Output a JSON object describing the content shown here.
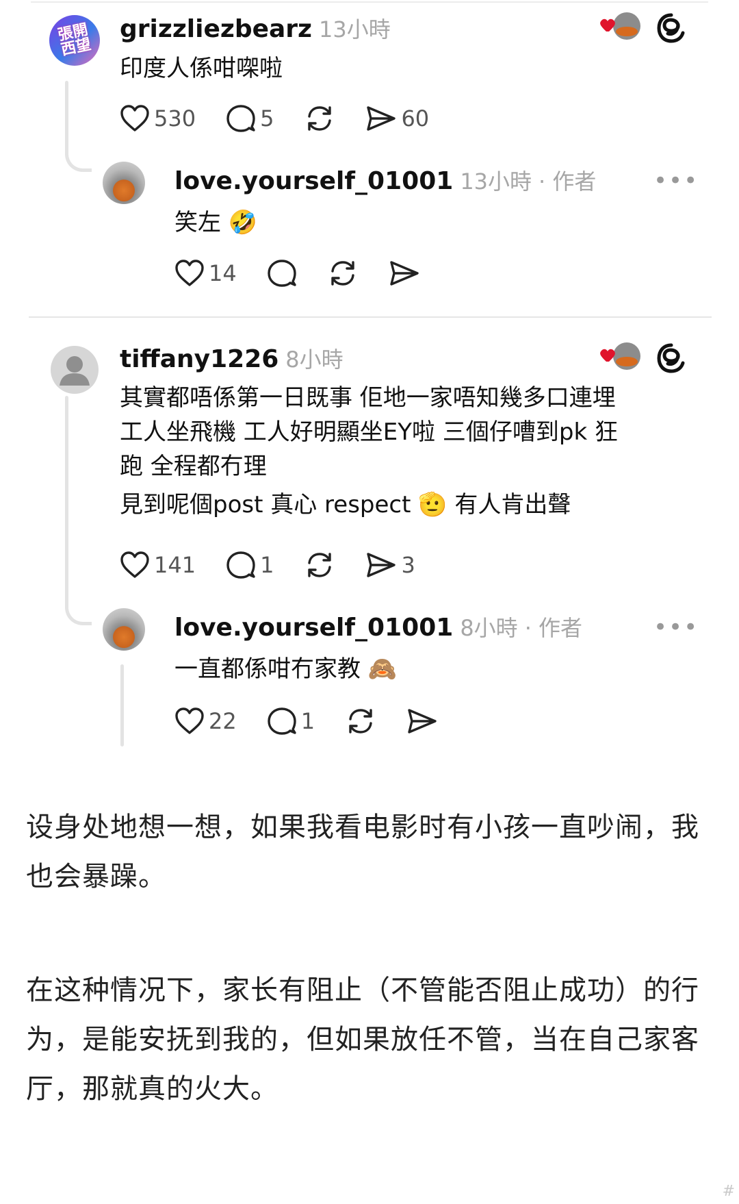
{
  "comments": [
    {
      "username": "grizzliezbearz",
      "time": "13小時",
      "avatar_text": "張開\n西望",
      "lines": [
        "印度人係咁㗎啦"
      ],
      "likes": "530",
      "replies": "5",
      "reposts": "",
      "shares": "60"
    },
    {
      "username": "love.yourself_01001",
      "time": "13小時",
      "author_tag": "· 作者",
      "lines": [
        "笑左 🤣"
      ],
      "likes": "14",
      "replies": "",
      "reposts": "",
      "shares": ""
    },
    {
      "username": "tiffany1226",
      "time": "8小時",
      "lines": [
        "其實都唔係第一日既事 佢地一家唔知幾多口連埋",
        "工人坐飛機 工人好明顯坐EY啦 三個仔嘈到pk 狂",
        "跑 全程都冇理",
        "見到呢個post 真心 respect 🫡 有人肯出聲"
      ],
      "likes": "141",
      "replies": "1",
      "reposts": "",
      "shares": "3"
    },
    {
      "username": "love.yourself_01001",
      "time": "8小時",
      "author_tag": "· 作者",
      "lines": [
        "一直都係咁冇家教 🙈"
      ],
      "likes": "22",
      "replies": "1",
      "reposts": "",
      "shares": ""
    }
  ],
  "icons": {
    "heart": "heart-icon",
    "comment": "comment-icon",
    "repost": "repost-icon",
    "share": "share-icon",
    "threads": "threads-logo-icon",
    "more": "more-icon"
  },
  "more_label": "•••",
  "article": {
    "paragraph_1": "设身处地想一想，如果我看电影时有小孩一直吵闹，我也会暴躁。",
    "paragraph_2": "在这种情况下，家长有阻止（不管能否阻止成功）的行为，是能安抚到我的，但如果放任不管，当在自己家客厅，那就真的火大。"
  },
  "watermark": "#"
}
